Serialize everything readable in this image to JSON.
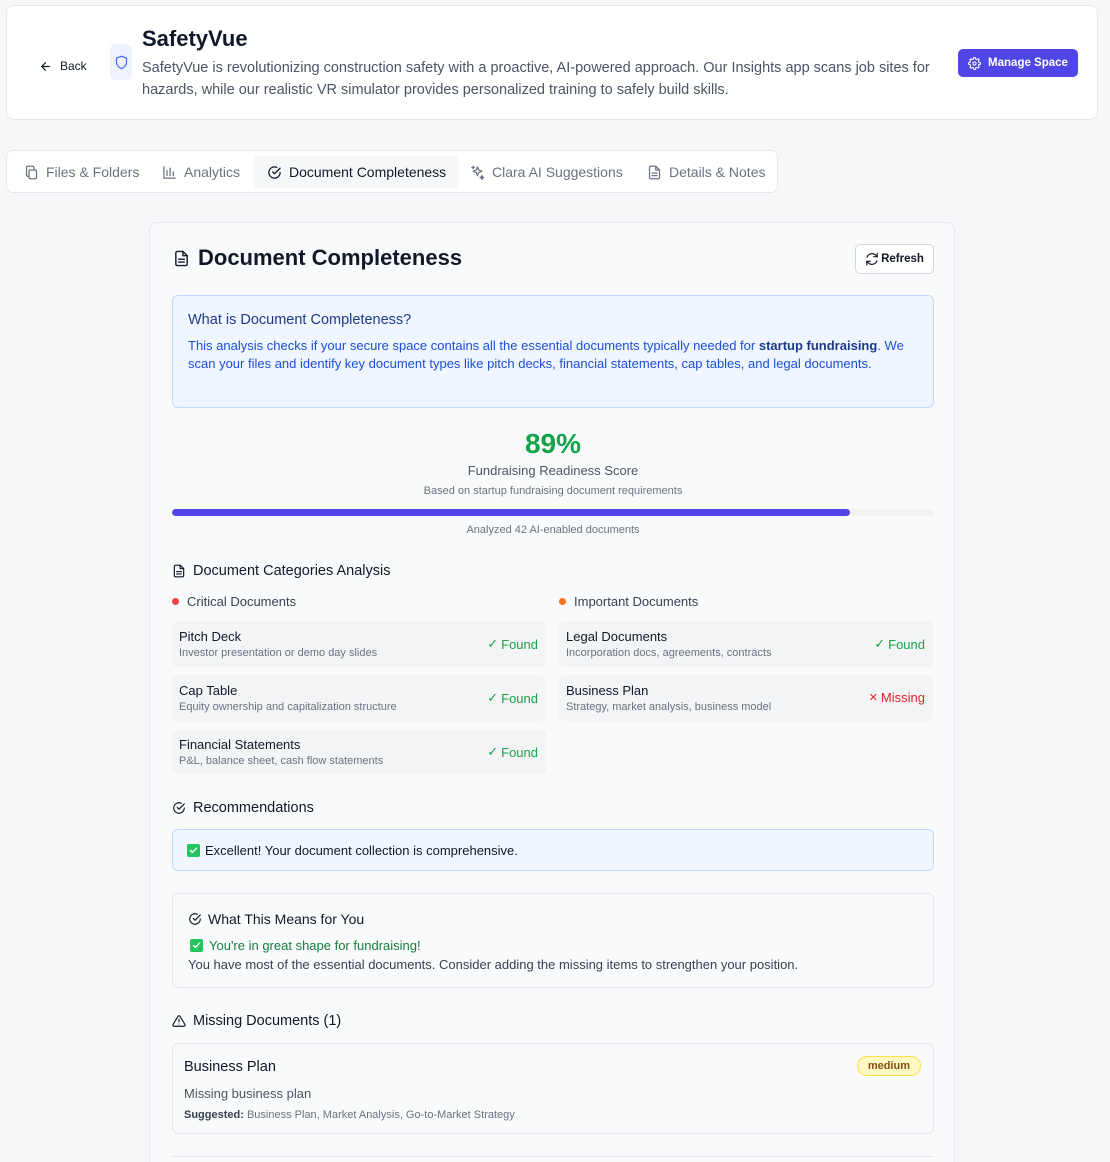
{
  "header": {
    "back_label": "Back",
    "title": "SafetyVue",
    "description": "SafetyVue is revolutionizing construction safety with a proactive, AI-powered approach. Our Insights app scans job sites for hazards, while our realistic VR simulator provides personalized training to safely build skills.",
    "manage_label": "Manage Space"
  },
  "tabs": [
    {
      "label": "Files & Folders",
      "icon": "copy-icon"
    },
    {
      "label": "Analytics",
      "icon": "bar-chart-icon"
    },
    {
      "label": "Document Completeness",
      "icon": "check-circle-icon",
      "active": true
    },
    {
      "label": "Clara AI Suggestions",
      "icon": "sparkles-icon"
    },
    {
      "label": "Details & Notes",
      "icon": "file-text-icon"
    }
  ],
  "card": {
    "title": "Document Completeness",
    "refresh_label": "Refresh",
    "info": {
      "title": "What is Document Completeness?",
      "text_before": "This analysis checks if your secure space contains all the essential documents typically needed for ",
      "text_bold": "startup fundraising",
      "text_after": ". We scan your files and identify key document types like pitch decks, financial statements, cap tables, and legal documents."
    },
    "score": {
      "value": "89%",
      "percent": 89,
      "label": "Fundraising Readiness Score",
      "sub": "Based on startup fundraising document requirements",
      "analyzed": "Analyzed 42 AI-enabled documents"
    },
    "categories": {
      "heading": "Document Categories Analysis",
      "critical": {
        "label": "Critical Documents",
        "color": "#ef4444",
        "items": [
          {
            "name": "Pitch Deck",
            "desc": "Investor presentation or demo day slides",
            "status": "Found"
          },
          {
            "name": "Cap Table",
            "desc": "Equity ownership and capitalization structure",
            "status": "Found"
          },
          {
            "name": "Financial Statements",
            "desc": "P&L, balance sheet, cash flow statements",
            "status": "Found"
          }
        ]
      },
      "important": {
        "label": "Important Documents",
        "color": "#f97316",
        "items": [
          {
            "name": "Legal Documents",
            "desc": "Incorporation docs, agreements, contracts",
            "status": "Found"
          },
          {
            "name": "Business Plan",
            "desc": "Strategy, market analysis, business model",
            "status": "Missing"
          }
        ]
      }
    },
    "recommendations": {
      "heading": "Recommendations",
      "text": "Excellent! Your document collection is comprehensive."
    },
    "means": {
      "heading": "What This Means for You",
      "good": "You're in great shape for fundraising!",
      "text": "You have most of the essential documents. Consider adding the missing items to strengthen your position."
    },
    "missing": {
      "heading": "Missing Documents (1)",
      "items": [
        {
          "name": "Business Plan",
          "badge": "medium",
          "desc": "Missing business plan",
          "suggested_label": "Suggested:",
          "suggested": "Business Plan, Market Analysis, Go-to-Market Strategy"
        }
      ]
    }
  },
  "colors": {
    "accent": "#4f46e5",
    "found": "#16a34a",
    "missing": "#dc2626",
    "score": "#16a34a"
  }
}
